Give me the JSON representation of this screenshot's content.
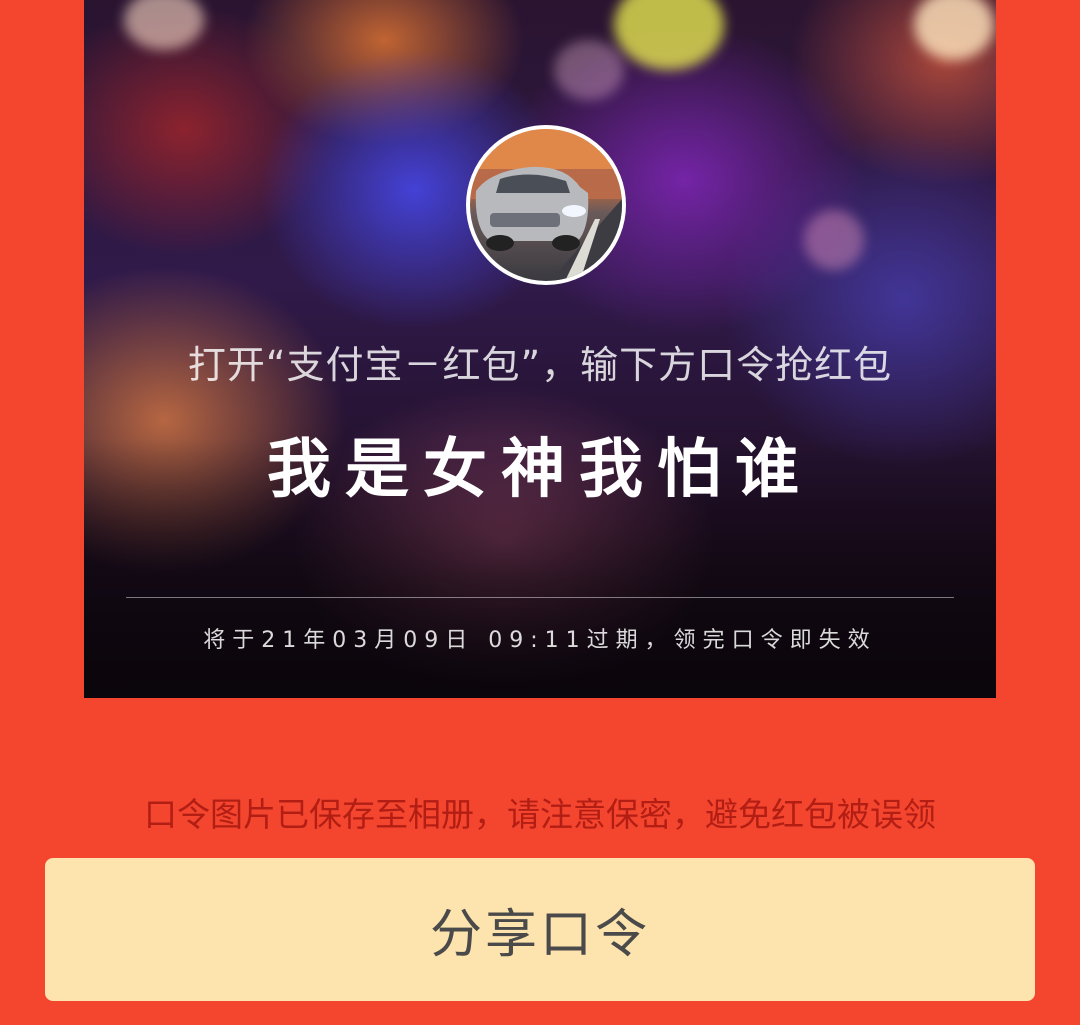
{
  "card": {
    "instruction": "打开“支付宝－红包”，输下方口令抢红包",
    "password": "我是女神我怕谁",
    "expiry": "将于21年03月09日  09:11过期，领完口令即失效",
    "avatar_icon": "car-avatar-icon"
  },
  "notice": "口令图片已保存至相册，请注意保密，避免红包被误领",
  "share_button": {
    "label": "分享口令"
  },
  "colors": {
    "background": "#f4462f",
    "button": "#fde3ad",
    "notice_text": "#b31e14"
  }
}
